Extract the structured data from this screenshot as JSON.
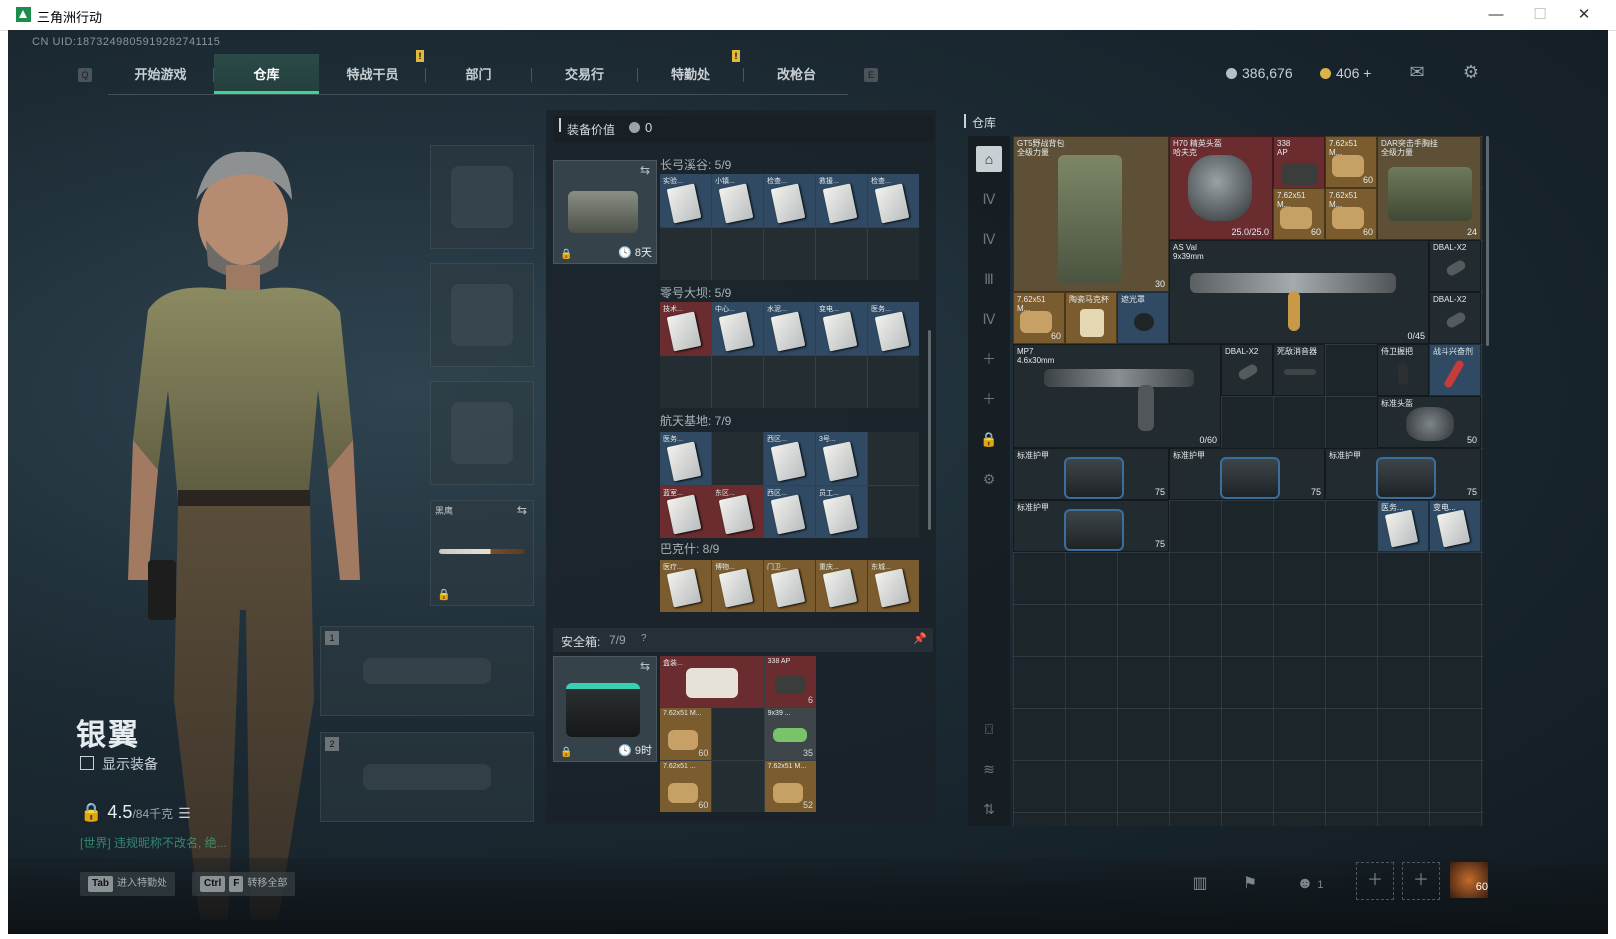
{
  "window": {
    "title": "三角洲行动",
    "min": "—",
    "max": "☐",
    "close": "✕"
  },
  "uid": "CN UID:1873249805919282741115",
  "nav": {
    "key_left": "Q",
    "key_right": "E",
    "tabs": [
      "开始游戏",
      "仓库",
      "特战干员",
      "部门",
      "交易行",
      "特勤处",
      "改枪台"
    ],
    "active": "仓库",
    "alert": "!"
  },
  "currency": {
    "silver": "386,676",
    "gold": "406 +",
    "silver_color": "#b8bfc2",
    "gold_color": "#d8b44a"
  },
  "top_icons": [
    "mail-icon",
    "gear-icon"
  ],
  "character": {
    "name": "银翼",
    "show_equipment": "显示装备",
    "weight": "4.5",
    "weight_cap": "/84千克",
    "chat": "[世界] 违规昵称不改名, 绝..."
  },
  "gear": {
    "melee_label": "黑鹰",
    "slot1": "1",
    "slot2": "2"
  },
  "equip_value": {
    "label": "装备价值",
    "value": "0"
  },
  "key_case": {
    "timer": "8天",
    "sections": [
      {
        "title": "长弓溪谷: 5/9",
        "cards": [
          "实验...",
          "小镇...",
          "检查...",
          "救援...",
          "检查..."
        ],
        "color": "blue"
      },
      {
        "title": "零号大坝: 5/9",
        "cards": [
          "技术...",
          "中心...",
          "水泥...",
          "变电...",
          "医务..."
        ],
        "color": "red"
      },
      {
        "title": "航天基地: 7/9",
        "cards": [
          "医务...",
          "",
          "西区...",
          "3号...",
          "蓝室...",
          "东区...",
          "西区...",
          "员工..."
        ],
        "color": "blue"
      },
      {
        "title": "巴克什: 8/9",
        "cards": [
          "医疗...",
          "博物...",
          "门卫...",
          "重庆...",
          "东城..."
        ],
        "color": "gold"
      }
    ]
  },
  "safe_box": {
    "label": "安全箱:",
    "count": "7/9",
    "help": "?",
    "timer": "9时",
    "items": [
      {
        "name": "盒装...",
        "count": ""
      },
      {
        "name": "338 AP",
        "count": "6"
      },
      {
        "name": "7.62x51 M...",
        "count": "60"
      },
      {
        "name": "9x39 ...",
        "count": "35"
      },
      {
        "name": "7.62x51 ...",
        "count": "60"
      },
      {
        "name": "7.62x51 M...",
        "count": "52"
      }
    ]
  },
  "warehouse": {
    "title": "仓库",
    "items": [
      {
        "name": "GT5野战背包\n全级力量",
        "count": "30"
      },
      {
        "name": "H70 精英头盔\n哈夫克",
        "dur": "25.0/25.0"
      },
      {
        "name": "338\nAP",
        "count": "7"
      },
      {
        "name": "7.62x51\nM...",
        "count": "60"
      },
      {
        "name": "DAR突击手胸挂\n全级力量",
        "count": "24"
      },
      {
        "name": "7.62x51\nM...",
        "count": "60"
      },
      {
        "name": "7.62x51\nM...",
        "count": "60"
      },
      {
        "name": "AS Val\n9x39mm",
        "count": "0/45"
      },
      {
        "name": "DBAL-X2",
        "count": ""
      },
      {
        "name": "DBAL-X2",
        "count": ""
      },
      {
        "name": "7.62x51\nM...",
        "count": "60"
      },
      {
        "name": "陶瓷马克杯",
        "count": ""
      },
      {
        "name": "遮光罩",
        "count": ""
      },
      {
        "name": "MP7\n4.6x30mm",
        "count": "0/60"
      },
      {
        "name": "DBAL-X2",
        "count": ""
      },
      {
        "name": "死敌消音器",
        "count": ""
      },
      {
        "name": "侍卫握把",
        "count": ""
      },
      {
        "name": "战斗兴奋剂",
        "count": ""
      },
      {
        "name": "标准头盔",
        "count": "50"
      },
      {
        "name": "标准护甲",
        "count": "75"
      },
      {
        "name": "标准护甲",
        "count": "75"
      },
      {
        "name": "标准护甲",
        "count": "75"
      },
      {
        "name": "标准护甲",
        "count": "75"
      },
      {
        "name": "医务...",
        "count": ""
      },
      {
        "name": "变电...",
        "count": ""
      }
    ]
  },
  "hints": [
    {
      "key": "Tab",
      "label": "进入特勤处"
    },
    {
      "key": "Ctrl",
      "key2": "F",
      "label": "转移全部"
    }
  ],
  "bottom_right": {
    "squad_count": "1",
    "ammo_count": "60"
  }
}
